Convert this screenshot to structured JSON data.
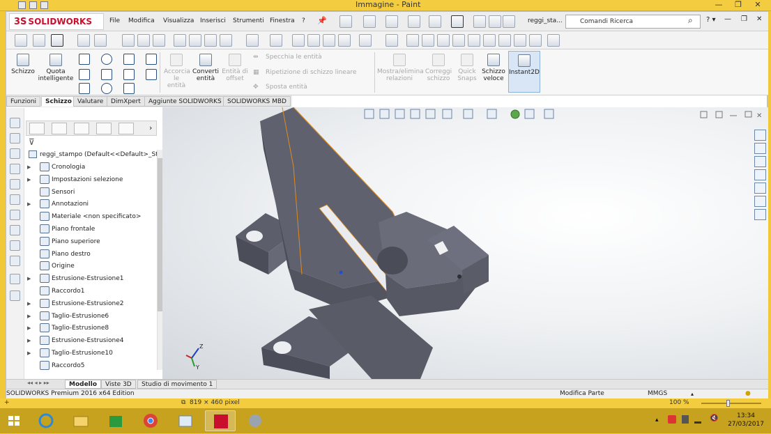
{
  "paint": {
    "title": "Immagine - Paint",
    "status_size": "819 × 460 pixel",
    "zoom": "100 %"
  },
  "sw": {
    "logo": "SOLIDWORKS",
    "logo_prefix": "3S",
    "menu": [
      "File",
      "Modifica",
      "Visualizza",
      "Inserisci",
      "Strumenti",
      "Finestra",
      "?"
    ],
    "doc_name": "reggi_sta...",
    "search_placeholder": "Comandi Ricerca",
    "ribbon": {
      "schizzo": "Schizzo",
      "quota_1": "Quota",
      "quota_2": "intelligente",
      "accorcia_1": "Accorcia",
      "accorcia_2": "le entità",
      "converti_1": "Converti",
      "converti_2": "entità",
      "offset_1": "Entità di",
      "offset_2": "offset",
      "specchia": "Specchia le entità",
      "ripetizione": "Ripetizione di schizzo lineare",
      "sposta": "Sposta entità",
      "mostra_1": "Mostra/elimina",
      "mostra_2": "relazioni",
      "correggi_1": "Correggi",
      "correggi_2": "schizzo",
      "quick_1": "Quick",
      "quick_2": "Snaps",
      "veloce_1": "Schizzo",
      "veloce_2": "veloce",
      "instant": "Instant2D"
    },
    "tabs": [
      "Funzioni",
      "Schizzo",
      "Valutare",
      "DimXpert",
      "Aggiunte SOLIDWORKS",
      "SOLIDWORKS MBD"
    ],
    "active_tab": "Schizzo",
    "tree_root": "reggi_stampo  (Default<<Default>_St",
    "tree": [
      {
        "label": "Cronologia",
        "arrow": true
      },
      {
        "label": "Impostazioni selezione",
        "arrow": true
      },
      {
        "label": "Sensori",
        "arrow": false
      },
      {
        "label": "Annotazioni",
        "arrow": true
      },
      {
        "label": "Materiale <non specificato>",
        "arrow": false
      },
      {
        "label": "Piano frontale",
        "arrow": false
      },
      {
        "label": "Piano superiore",
        "arrow": false
      },
      {
        "label": "Piano destro",
        "arrow": false
      },
      {
        "label": "Origine",
        "arrow": false
      },
      {
        "label": "Estrusione-Estrusione1",
        "arrow": true
      },
      {
        "label": "Raccordo1",
        "arrow": false
      },
      {
        "label": "Estrusione-Estrusione2",
        "arrow": true
      },
      {
        "label": "Taglio-Estrusione6",
        "arrow": true
      },
      {
        "label": "Taglio-Estrusione8",
        "arrow": true
      },
      {
        "label": "Estrusione-Estrusione4",
        "arrow": true
      },
      {
        "label": "Taglio-Estrusione10",
        "arrow": true
      },
      {
        "label": "Raccordo5",
        "arrow": false
      }
    ],
    "bottom_tabs": [
      "Modello",
      "Viste 3D",
      "Studio di movimento 1"
    ],
    "status_left": "SOLIDWORKS Premium 2016 x64 Edition",
    "status_mid": "Modifica Parte",
    "status_units": "MMGS",
    "triad_z": "Z",
    "triad_y": "Y"
  },
  "taskbar": {
    "time": "13:34",
    "date": "27/03/2017"
  },
  "colors": {
    "accent": "#c8102e",
    "model": "#5b5d69",
    "edge": "#e08a1e",
    "paint_frame": "#f0c838"
  }
}
